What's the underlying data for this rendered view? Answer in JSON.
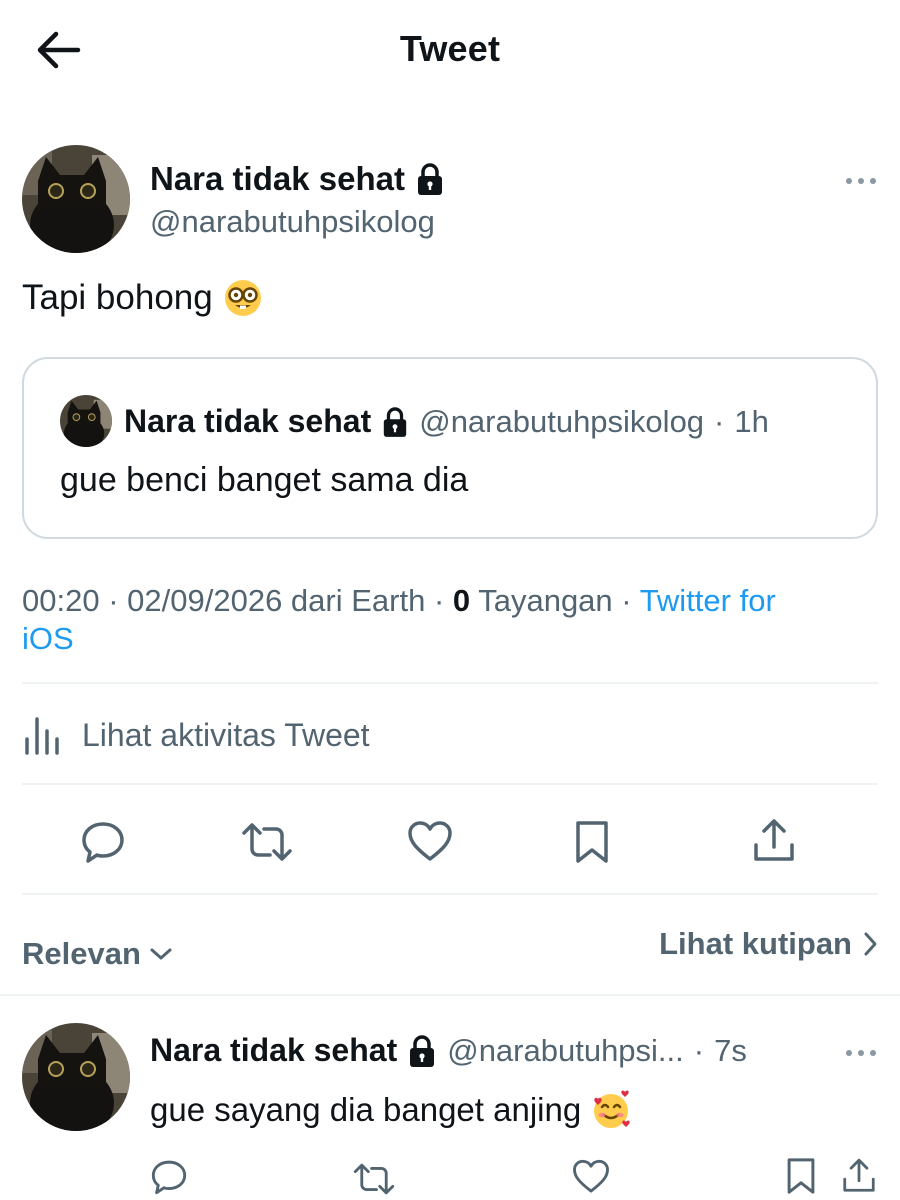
{
  "header": {
    "title": "Tweet",
    "back_icon": "arrow-left-icon"
  },
  "tweet": {
    "author_name": "Nara tidak sehat",
    "author_handle": "@narabutuhpsikolog",
    "text": "Tapi bohong",
    "emoji_icon": "nerd-face-icon",
    "quoted": {
      "author_name": "Nara tidak sehat",
      "author_handle": "@narabutuhpsikolog",
      "separator": "·",
      "time": "1h",
      "text": "gue benci banget sama dia"
    },
    "meta": {
      "time": "00:20",
      "sep1": "·",
      "date_place": "02/09/2026 dari Earth",
      "sep2": "·",
      "views_count": "0",
      "views_label": "Tayangan",
      "sep3": "·",
      "source_line1": "Twitter for",
      "source_line2": "iOS"
    },
    "activity_label": "Lihat aktivitas Tweet",
    "actions": [
      "reply-icon",
      "retweet-icon",
      "like-icon",
      "bookmark-icon",
      "share-icon"
    ]
  },
  "filters": {
    "sort_label": "Relevan",
    "quotes_label": "Lihat kutipan"
  },
  "reply": {
    "author_name": "Nara tidak sehat",
    "author_handle": "@narabutuhpsi...",
    "separator": "·",
    "time": "7s",
    "text": "gue sayang dia banget anjing",
    "emoji_icon": "smiling-face-with-hearts-icon"
  },
  "colors": {
    "text_primary": "#0f1419",
    "text_secondary": "#536471",
    "link": "#1d9bf0",
    "border": "#cfd9de",
    "divider": "#eff3f4"
  }
}
